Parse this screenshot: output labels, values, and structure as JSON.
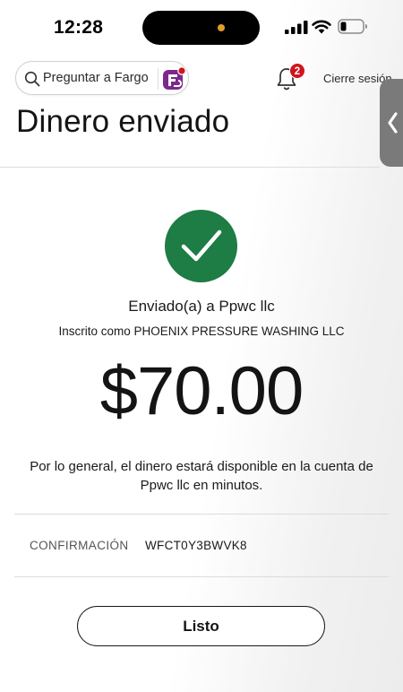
{
  "status_bar": {
    "time": "12:28",
    "icons": [
      "signal-icon",
      "wifi-icon",
      "battery-icon"
    ]
  },
  "header": {
    "search_placeholder": "Preguntar a Fargo",
    "notifications_count": "2",
    "logout_label": "Cierre sesión"
  },
  "page": {
    "title": "Dinero enviado"
  },
  "confirmation": {
    "sent_to": "Enviado(a) a Ppwc llc",
    "enrolled_as": "Inscrito como PHOENIX PRESSURE WASHING LLC",
    "amount": "$70.00",
    "availability_note": "Por lo general, el dinero estará disponible en la cuenta de Ppwc llc en minutos.",
    "confirmation_label": "CONFIRMACIÓN",
    "confirmation_code": "WFCT0Y3BWVK8"
  },
  "actions": {
    "done_label": "Listo"
  },
  "colors": {
    "success_green": "#1e7c45",
    "badge_red": "#d2141c",
    "fargo_purple": "#7b2a8c"
  }
}
